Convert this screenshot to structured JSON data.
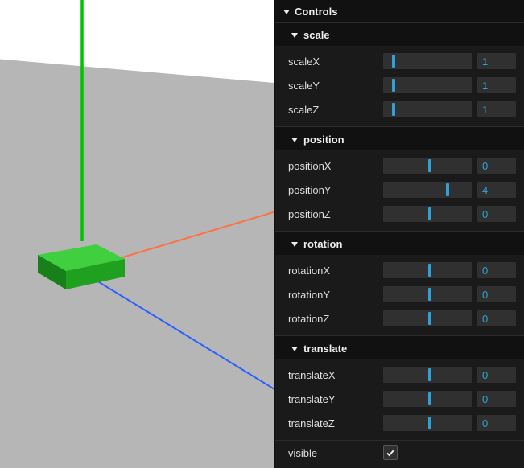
{
  "panel": {
    "title": "Controls"
  },
  "folders": [
    {
      "name": "scale",
      "controls": [
        {
          "label": "scaleX",
          "value": 1,
          "frac": 0.1
        },
        {
          "label": "scaleY",
          "value": 1,
          "frac": 0.1
        },
        {
          "label": "scaleZ",
          "value": 1,
          "frac": 0.1
        }
      ]
    },
    {
      "name": "position",
      "controls": [
        {
          "label": "positionX",
          "value": 0,
          "frac": 0.5
        },
        {
          "label": "positionY",
          "value": 4,
          "frac": 0.7
        },
        {
          "label": "positionZ",
          "value": 0,
          "frac": 0.5
        }
      ]
    },
    {
      "name": "rotation",
      "controls": [
        {
          "label": "rotationX",
          "value": 0,
          "frac": 0.5
        },
        {
          "label": "rotationY",
          "value": 0,
          "frac": 0.5
        },
        {
          "label": "rotationZ",
          "value": 0,
          "frac": 0.5
        }
      ]
    },
    {
      "name": "translate",
      "controls": [
        {
          "label": "translateX",
          "value": 0,
          "frac": 0.5
        },
        {
          "label": "translateY",
          "value": 0,
          "frac": 0.5
        },
        {
          "label": "translateZ",
          "value": 0,
          "frac": 0.5
        }
      ]
    }
  ],
  "booleans": {
    "visible": {
      "label": "visible",
      "checked": true
    }
  },
  "scene": {
    "axis_colors": {
      "x": "#ff7043",
      "y": "#00c400",
      "z": "#2962ff"
    },
    "ground_color": "#b6b6b6",
    "box_color": "#1fa01f",
    "box_top_color": "#3fcf3f"
  }
}
